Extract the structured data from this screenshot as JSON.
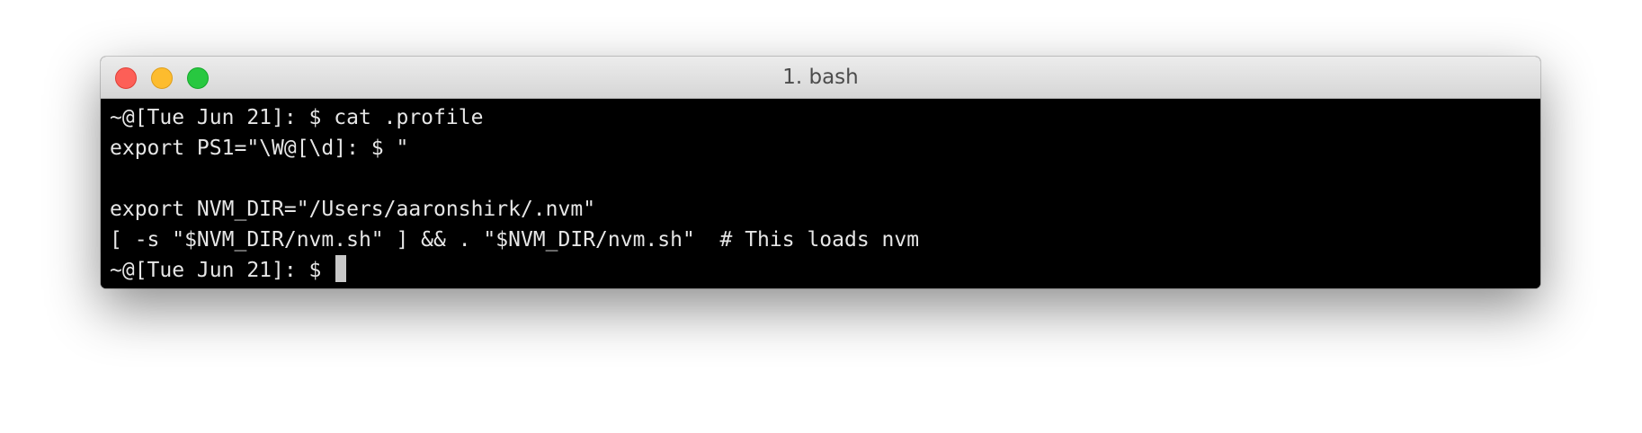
{
  "window": {
    "title": "1. bash"
  },
  "terminal": {
    "lines": [
      "~@[Tue Jun 21]: $ cat .profile",
      "export PS1=\"\\W@[\\d]: $ \"",
      "",
      "export NVM_DIR=\"/Users/aaronshirk/.nvm\"",
      "[ -s \"$NVM_DIR/nvm.sh\" ] && . \"$NVM_DIR/nvm.sh\"  # This loads nvm"
    ],
    "prompt": "~@[Tue Jun 21]: $ "
  },
  "colors": {
    "terminal_bg": "#000000",
    "terminal_fg": "#e6e6e6",
    "close": "#fd5f57",
    "minimize": "#fdbc2e",
    "maximize": "#28c840"
  }
}
